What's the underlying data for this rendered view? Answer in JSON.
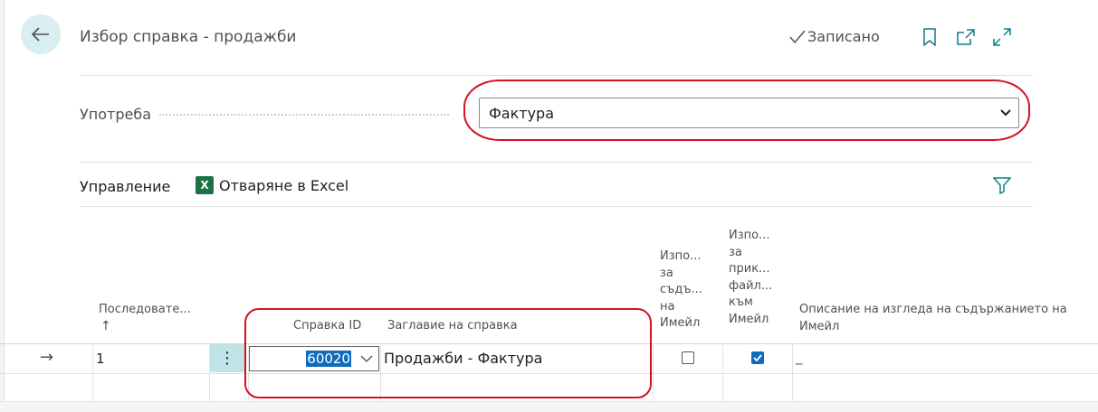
{
  "header": {
    "title": "Избор справка - продажби",
    "saved_label": "Записано"
  },
  "usage": {
    "label": "Употреба",
    "selected": "Фактура"
  },
  "toolbar": {
    "manage_label": "Управление",
    "excel_label": "Отваряне в Excel",
    "excel_badge": "X"
  },
  "table": {
    "columns": {
      "sequence": "Последовате...",
      "sort_arrow": "↑",
      "report_id": "Справка ID",
      "report_title": "Заглавие на справка",
      "use_body_lines": [
        "Изпо...",
        "за",
        "съдъ...",
        "на",
        "Имейл"
      ],
      "attach_lines": [
        "Изпо...",
        "за",
        "прик...",
        "файл...",
        "към",
        "Имейл"
      ],
      "email_layout": "Описание на изгледа на съдържанието на Имейл"
    },
    "rows": [
      {
        "arrow": "→",
        "sequence": "1",
        "more": "⋮",
        "report_id": "60020",
        "report_title": "Продажби - Фактура",
        "use_for_email_body": false,
        "use_for_email_attachment": true,
        "email_layout": "_"
      }
    ]
  }
}
